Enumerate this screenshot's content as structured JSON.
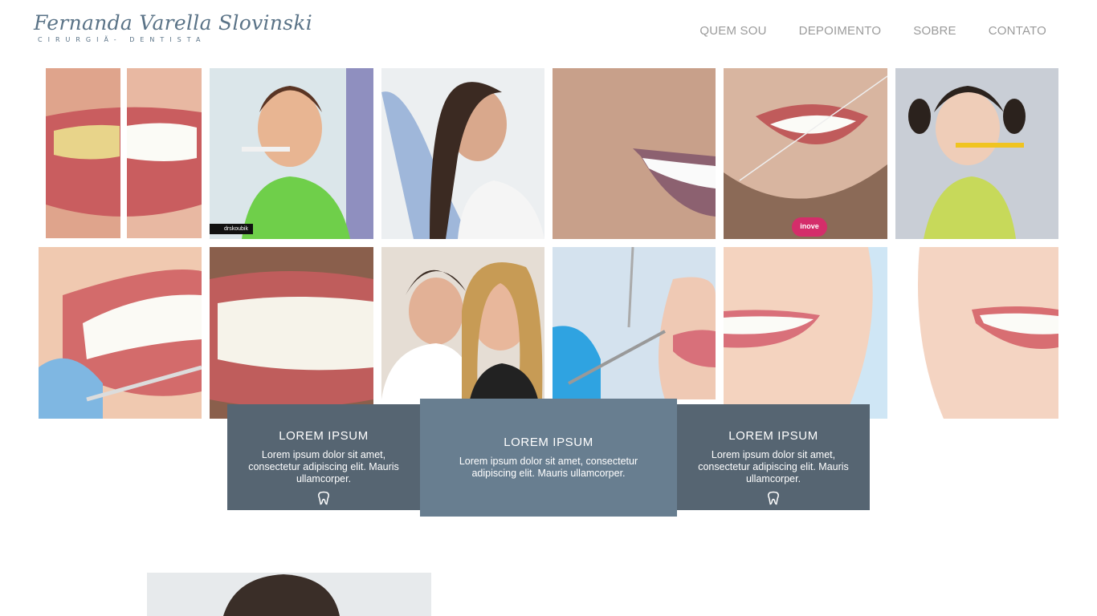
{
  "header": {
    "logo_name": "Fernanda Varella Slovinski",
    "logo_subtitle": "CIRURGIÃ- DENTISTA",
    "nav": [
      "QUEM SOU",
      "DEPOIMENTO",
      "SOBRE",
      "CONTATO"
    ]
  },
  "gallery": {
    "items": [
      {
        "name": "whitening-before-after-photo"
      },
      {
        "name": "boy-brushing-teeth-photo",
        "overlay_text": "drskoubik"
      },
      {
        "name": "woman-dental-chair-photo"
      },
      {
        "name": "smile-closeup-photo"
      },
      {
        "name": "man-flossing-photo",
        "overlay_text": "inove"
      },
      {
        "name": "girl-brushing-teeth-photo"
      },
      {
        "name": "teeth-cleaning-photo"
      },
      {
        "name": "teeth-closeup-photo"
      },
      {
        "name": "dentist-selfie-photo"
      },
      {
        "name": "dental-exam-photo"
      },
      {
        "name": "white-smile-photo"
      },
      {
        "name": "smile-lower-face-photo"
      }
    ]
  },
  "features": [
    {
      "title": "LOREM IPSUM",
      "text": "Lorem ipsum dolor sit amet, consectetur adipiscing elit. Mauris ullamcorper.",
      "icon": "tooth-icon"
    },
    {
      "title": "LOREM IPSUM",
      "text": "Lorem ipsum dolor sit amet, consectetur adipiscing elit. Mauris ullamcorper."
    },
    {
      "title": "LOREM IPSUM",
      "text": "Lorem ipsum dolor sit amet, consectetur adipiscing elit. Mauris ullamcorper.",
      "icon": "tooth-icon"
    }
  ],
  "colors": {
    "brand": "#5a7387",
    "card_dark": "#566572",
    "card_mid": "#687e90",
    "nav_text": "#9b9b9b"
  }
}
